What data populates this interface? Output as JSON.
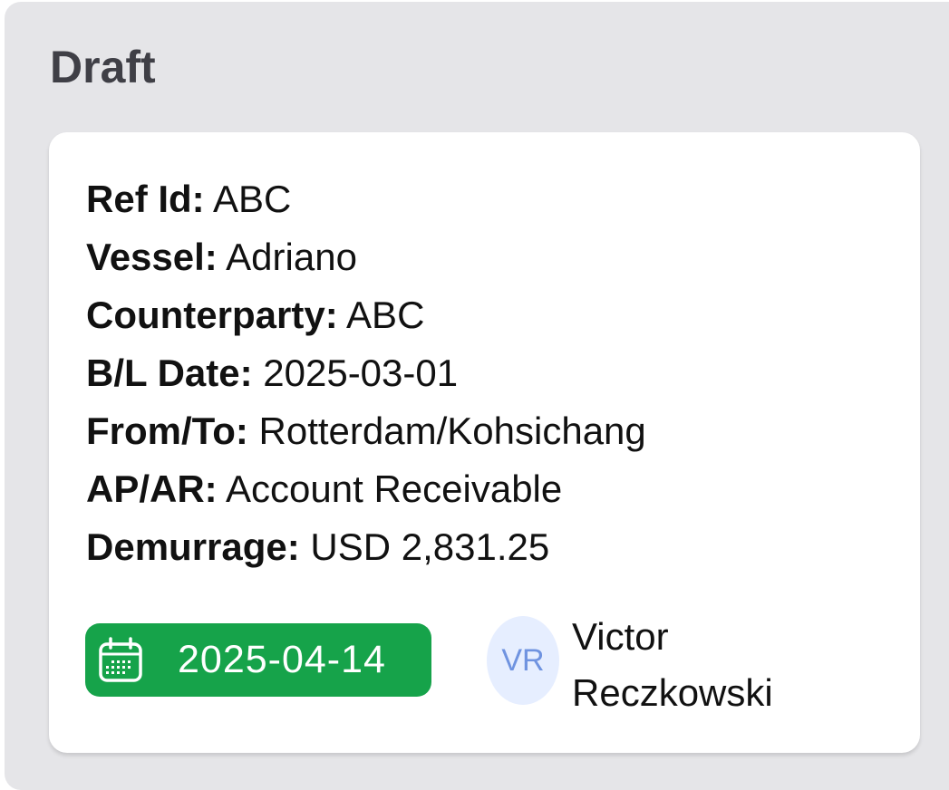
{
  "column": {
    "title": "Draft"
  },
  "card": {
    "fields": [
      {
        "label": "Ref Id:",
        "value": "ABC"
      },
      {
        "label": "Vessel:",
        "value": "Adriano"
      },
      {
        "label": "Counterparty:",
        "value": "ABC"
      },
      {
        "label": "B/L Date:",
        "value": "2025-03-01"
      },
      {
        "label": "From/To:",
        "value": "Rotterdam/Kohsichang"
      },
      {
        "label": "AP/AR:",
        "value": "Account Receivable"
      },
      {
        "label": "Demurrage:",
        "value": "USD 2,831.25"
      }
    ],
    "due_date": {
      "icon": "calendar-icon",
      "value": "2025-04-14",
      "color": "#16a34a"
    },
    "assignee": {
      "initials": "VR",
      "first_name": "Victor",
      "last_name": "Reczkowski"
    }
  }
}
